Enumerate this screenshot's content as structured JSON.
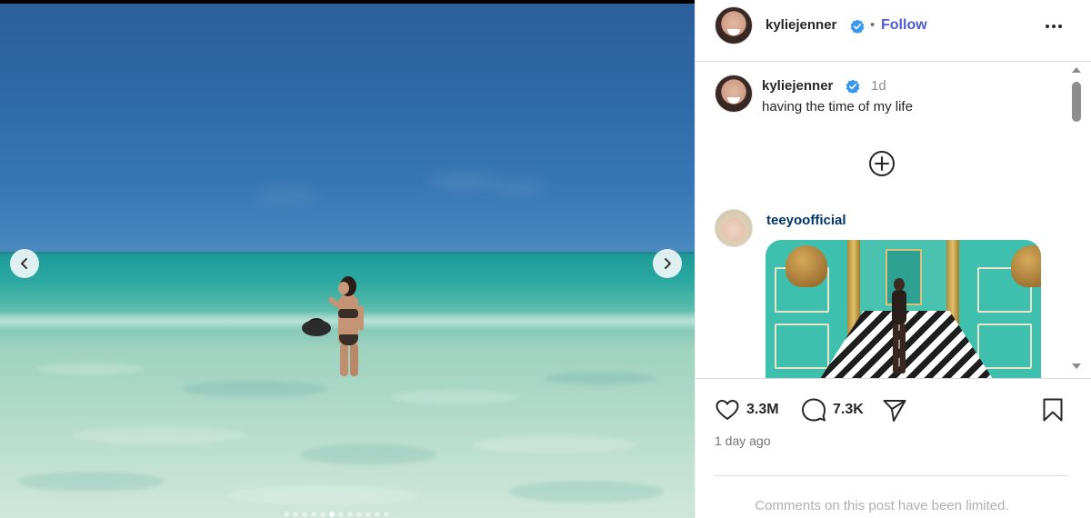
{
  "post": {
    "author": "kyliejenner",
    "follow_label": "Follow",
    "separator": "•",
    "caption": "having the time of my life",
    "caption_time": "1d",
    "likes": "3.3M",
    "comments_count": "7.3K",
    "posted_ago": "1 day ago",
    "comments_limited_notice": "Comments on this post have been limited.",
    "carousel": {
      "total_slides": 12,
      "active_index": 5
    }
  },
  "comments": [
    {
      "user": "teeyoofficial",
      "attachment": "gif"
    }
  ],
  "icons": {
    "verified": "verified-badge-icon",
    "more": "more-options-icon",
    "load_more": "plus-circle-icon",
    "like": "heart-icon",
    "comment": "comment-bubble-icon",
    "share": "send-icon",
    "save": "bookmark-icon",
    "prev": "chevron-left-icon",
    "next": "chevron-right-icon"
  },
  "colors": {
    "follow": "#4f5bd5",
    "verified": "#3897f0",
    "reply_username": "#00376b",
    "muted": "#737373"
  }
}
